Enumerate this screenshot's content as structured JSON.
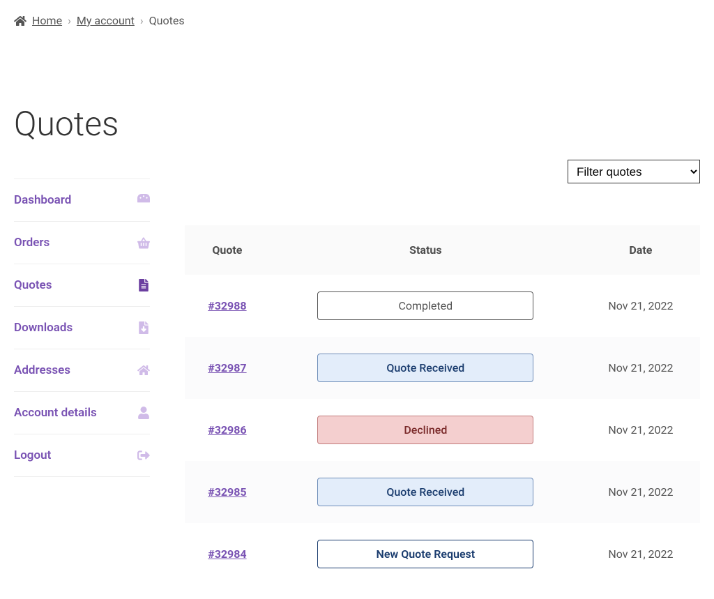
{
  "breadcrumb": {
    "home": "Home",
    "myaccount": "My account",
    "current": "Quotes"
  },
  "page_title": "Quotes",
  "sidebar": {
    "items": [
      {
        "label": "Dashboard",
        "icon": "dashboard"
      },
      {
        "label": "Orders",
        "icon": "basket"
      },
      {
        "label": "Quotes",
        "icon": "file",
        "active": true
      },
      {
        "label": "Downloads",
        "icon": "download-file"
      },
      {
        "label": "Addresses",
        "icon": "home"
      },
      {
        "label": "Account details",
        "icon": "user"
      },
      {
        "label": "Logout",
        "icon": "logout"
      }
    ]
  },
  "filter": {
    "selected": "Filter quotes"
  },
  "table": {
    "headers": {
      "quote": "Quote",
      "status": "Status",
      "date": "Date"
    },
    "rows": [
      {
        "id": "#32988",
        "status": "Completed",
        "status_class": "status-completed",
        "date": "Nov 21, 2022"
      },
      {
        "id": "#32987",
        "status": "Quote Received",
        "status_class": "status-received",
        "date": "Nov 21, 2022"
      },
      {
        "id": "#32986",
        "status": "Declined",
        "status_class": "status-declined",
        "date": "Nov 21, 2022"
      },
      {
        "id": "#32985",
        "status": "Quote Received",
        "status_class": "status-received",
        "date": "Nov 21, 2022"
      },
      {
        "id": "#32984",
        "status": "New Quote Request",
        "status_class": "status-new",
        "date": "Nov 21, 2022"
      }
    ]
  }
}
